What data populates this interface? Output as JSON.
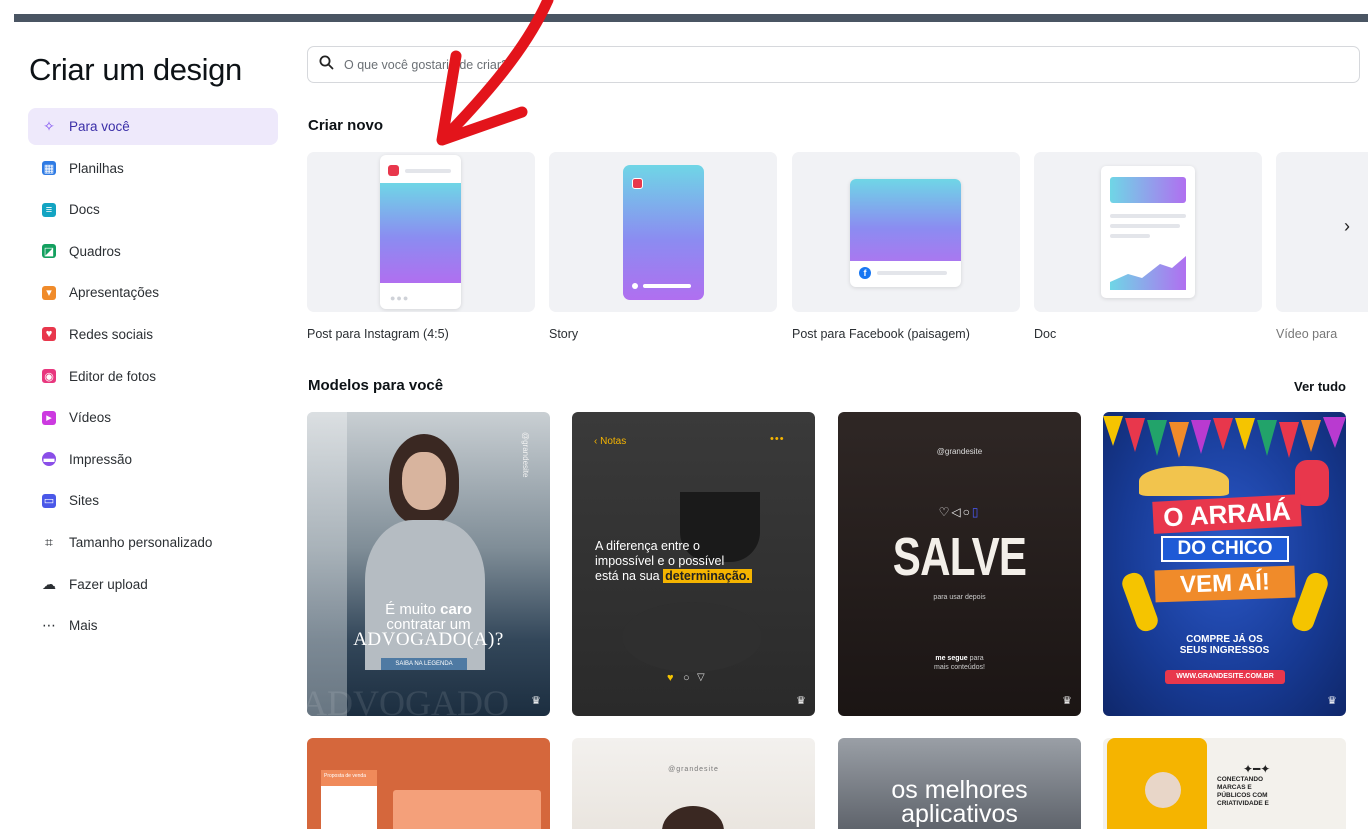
{
  "page": {
    "title": "Criar um design"
  },
  "search": {
    "placeholder": "O que você gostaria de criar?"
  },
  "sidebar": {
    "items": [
      {
        "label": "Para você",
        "icon": "sparkle-icon",
        "color": "#7d4ef0",
        "active": true
      },
      {
        "label": "Planilhas",
        "icon": "sheet-icon",
        "color": "#2f7be4"
      },
      {
        "label": "Docs",
        "icon": "docs-icon",
        "color": "#13a4c2"
      },
      {
        "label": "Quadros",
        "icon": "whiteboard-icon",
        "color": "#13a05f"
      },
      {
        "label": "Apresentações",
        "icon": "presentation-icon",
        "color": "#f08b2a"
      },
      {
        "label": "Redes sociais",
        "icon": "social-icon",
        "color": "#e8374c"
      },
      {
        "label": "Editor de fotos",
        "icon": "photo-editor-icon",
        "color": "#e8377e"
      },
      {
        "label": "Vídeos",
        "icon": "video-icon",
        "color": "#cc3ae0"
      },
      {
        "label": "Impressão",
        "icon": "print-icon",
        "color": "#8a4ee8"
      },
      {
        "label": "Sites",
        "icon": "sites-icon",
        "color": "#4a58e8"
      },
      {
        "label": "Tamanho personalizado",
        "icon": "custom-size-icon",
        "color": "#2b2f33"
      },
      {
        "label": "Fazer upload",
        "icon": "upload-icon",
        "color": "#2b2f33"
      },
      {
        "label": "Mais",
        "icon": "more-icon",
        "color": "#2b2f33"
      }
    ]
  },
  "create_new": {
    "title": "Criar novo",
    "cards": [
      {
        "label": "Post para Instagram (4:5)"
      },
      {
        "label": "Story"
      },
      {
        "label": "Post para Facebook (paisagem)"
      },
      {
        "label": "Doc"
      },
      {
        "label": "Vídeo para"
      }
    ]
  },
  "templates": {
    "title": "Modelos para você",
    "see_all": "Ver tudo",
    "t1": {
      "handle": "@grandesite",
      "line1": "É muito",
      "bold": "caro",
      "line2": "contratar um",
      "line3": "ADVOGADO(A)?",
      "button": "SAIBA NA LEGENDA",
      "bg_text": "ADVOGADO"
    },
    "t2": {
      "back": "Notas",
      "line1": "A diferença entre o",
      "line2": "impossível e o possível",
      "line3": "está na sua",
      "highlight": "determinação."
    },
    "t3": {
      "handle": "@grandesite",
      "big": "SALVE",
      "sub": "para usar depois",
      "foot_bold": "me segue",
      "foot1": "para",
      "foot2": "mais conteúdos!"
    },
    "t4": {
      "line1": "O ARRAIÁ",
      "line2": "DO CHICO",
      "line3": "VEM AÍ!",
      "cta1": "COMPRE JÁ OS",
      "cta2": "SEUS INGRESSOS",
      "url": "WWW.GRANDESITE.COM.BR"
    },
    "r2a": {
      "title": "Proposta de venda"
    },
    "r2b": {
      "handle": "@grandesite"
    },
    "r2c": {
      "line1": "os melhores",
      "line2": "aplicativos"
    },
    "r2d": {
      "l1": "CONECTANDO",
      "l2": "MARCAS E",
      "l3": "PÚBLICOS COM",
      "l4": "CRIATIVIDADE E"
    }
  },
  "colors": {
    "accent": "#7d4ef0",
    "active_bg": "#eee9fb",
    "arrow": "#e3141b"
  }
}
